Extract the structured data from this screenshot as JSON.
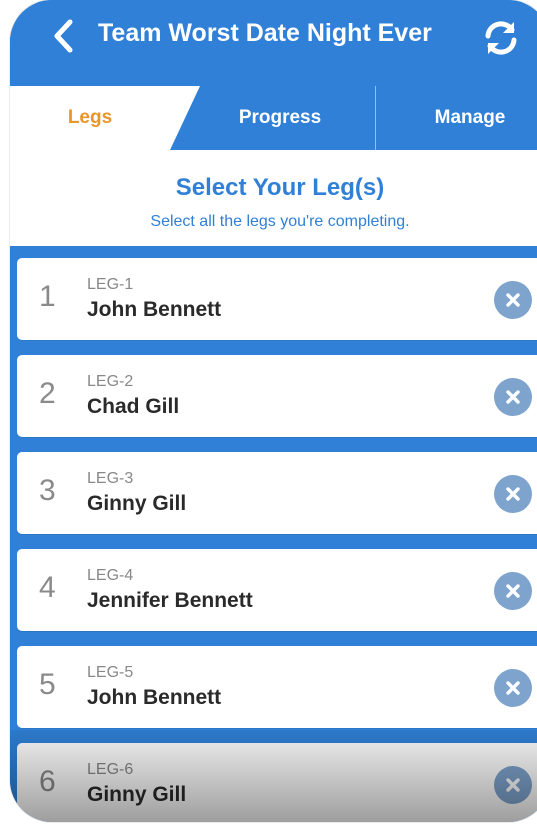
{
  "app": {
    "title": "Team Worst Date Night Ever"
  },
  "tabs": [
    {
      "label": "Legs",
      "active": true
    },
    {
      "label": "Progress",
      "active": false
    },
    {
      "label": "Manage",
      "active": false
    }
  ],
  "header": {
    "heading": "Select Your Leg(s)",
    "subheading": "Select all the legs you're completing."
  },
  "legs": [
    {
      "number": "1",
      "code": "LEG-1",
      "name": "John Bennett"
    },
    {
      "number": "2",
      "code": "LEG-2",
      "name": "Chad Gill"
    },
    {
      "number": "3",
      "code": "LEG-3",
      "name": "Ginny Gill"
    },
    {
      "number": "4",
      "code": "LEG-4",
      "name": "Jennifer Bennett"
    },
    {
      "number": "5",
      "code": "LEG-5",
      "name": "John Bennett"
    },
    {
      "number": "6",
      "code": "LEG-6",
      "name": "Ginny Gill"
    }
  ],
  "icons": {
    "back": "chevron-left-icon",
    "refresh": "refresh-icon",
    "remove": "close-circle-icon"
  },
  "colors": {
    "brand_blue": "#2f80d6",
    "active_tab_text": "#e8962a",
    "remove_button": "#7ea3cd"
  }
}
